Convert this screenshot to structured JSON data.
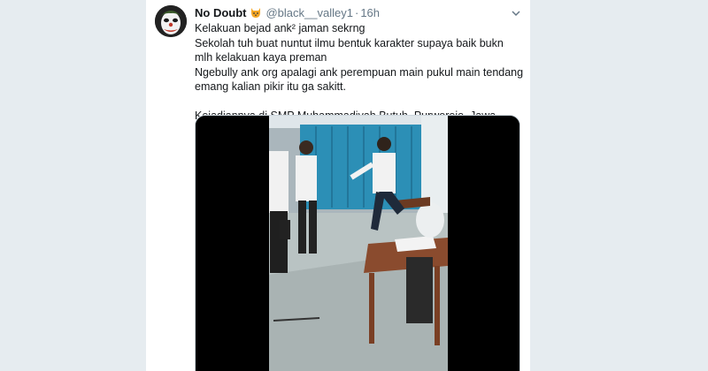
{
  "tweet": {
    "author_name": "No Doubt",
    "handle": "@black__valley1",
    "separator": "·",
    "time": "16h",
    "lines": [
      "Kelakuan bejad ank² jaman sekrng",
      "Sekolah tuh buat nuntut ilmu bentuk karakter supaya baik bukn mlh kelakuan kaya preman",
      "Ngebully ank org apalagi ank perempuan main pukul main tendang emang kalian pikir itu ga sakitt.",
      "Kejadiannya di SMP Muhammadiyah Butuh, Purworejo, Jawa Tengah"
    ]
  },
  "colors": {
    "background": "#e6ecf0",
    "text": "#14171a",
    "secondary": "#657786",
    "badge": "#f5a623"
  },
  "icons": {
    "badge": "dog-emoji-icon",
    "menu": "chevron-down-icon",
    "avatar": "clown-avatar"
  }
}
